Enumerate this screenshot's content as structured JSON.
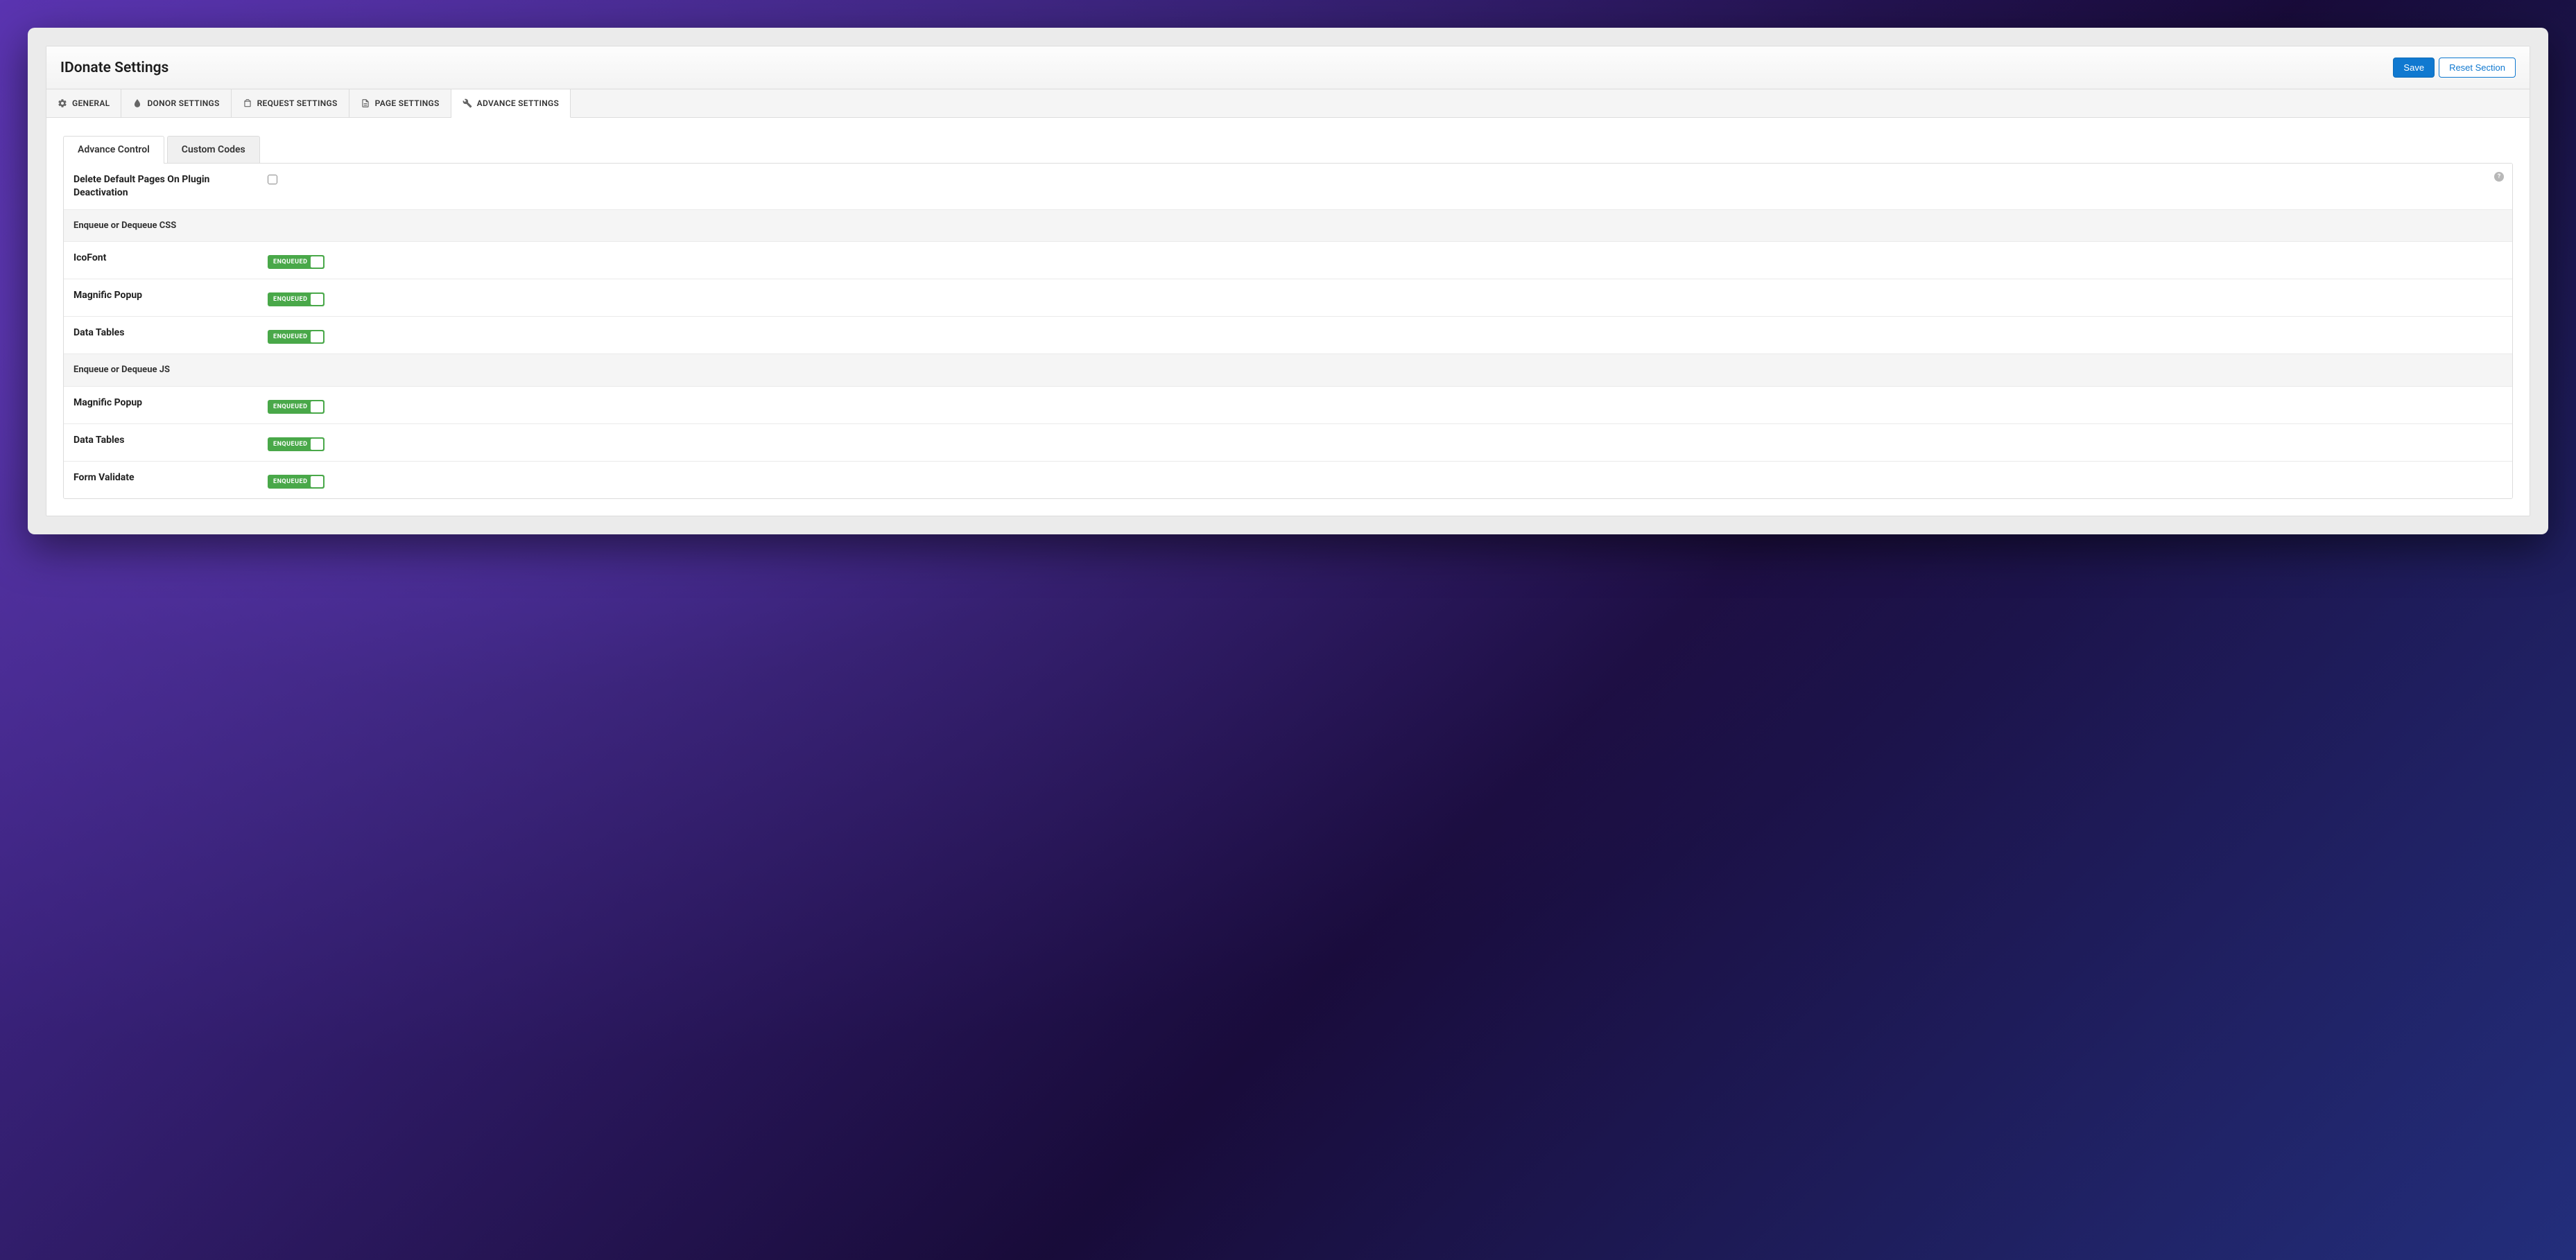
{
  "pageTitle": "IDonate Settings",
  "actions": {
    "save": "Save",
    "reset": "Reset Section"
  },
  "primaryTabs": [
    {
      "label": "GENERAL",
      "active": false
    },
    {
      "label": "DONOR SETTINGS",
      "active": false
    },
    {
      "label": "REQUEST SETTINGS",
      "active": false
    },
    {
      "label": "PAGE SETTINGS",
      "active": false
    },
    {
      "label": "ADVANCE SETTINGS",
      "active": true
    }
  ],
  "subTabs": [
    {
      "label": "Advance Control",
      "active": true
    },
    {
      "label": "Custom Codes",
      "active": false
    }
  ],
  "rows": {
    "deletePages": {
      "label": "Delete Default Pages On Plugin Deactivation",
      "checked": false
    },
    "cssHeader": "Enqueue or Dequeue CSS",
    "css": [
      {
        "label": "IcoFont",
        "state": "ENQUEUED"
      },
      {
        "label": "Magnific Popup",
        "state": "ENQUEUED"
      },
      {
        "label": "Data Tables",
        "state": "ENQUEUED"
      }
    ],
    "jsHeader": "Enqueue or Dequeue JS",
    "js": [
      {
        "label": "Magnific Popup",
        "state": "ENQUEUED"
      },
      {
        "label": "Data Tables",
        "state": "ENQUEUED"
      },
      {
        "label": "Form Validate",
        "state": "ENQUEUED"
      }
    ]
  },
  "icons": {
    "help": "?"
  }
}
